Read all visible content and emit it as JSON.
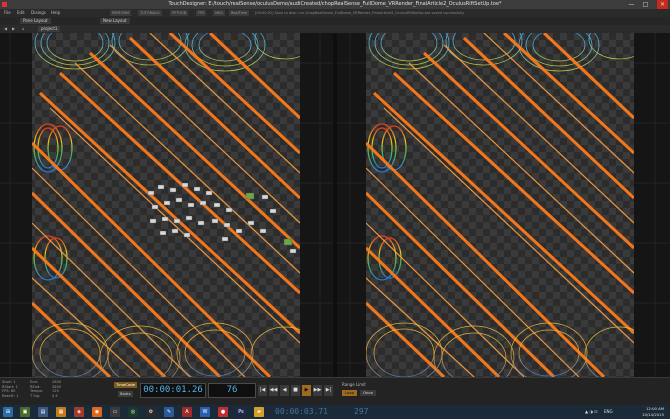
{
  "window": {
    "title": "TouchDesigner: E:/touch/realSense/oculusDemo/audiCreated/chopRealSense_FullDome_VRRender_FinalArticle2_OculusRiftSetUp.toe*",
    "controls": [
      "—",
      "□",
      "✕"
    ]
  },
  "menu": {
    "items": [
      "File",
      "Edit",
      "Dialogs",
      "Help"
    ],
    "tags": [
      "PERFORM",
      "TUTORIALS",
      "PYTHON",
      "FPS",
      "MSG",
      "RealTime"
    ],
    "path_text": "[00:00:52] Save to disk: run /chopRealSense_FullDome_VRRender_FinalArticle2_OculusRiftSetUp.toe saved successfully"
  },
  "panes": {
    "tabs": [
      "Pane Layout",
      "New Layout"
    ]
  },
  "network": {
    "crumb": "project1"
  },
  "stats": {
    "col1": [
      "Start:",
      "RStart:",
      "FPS:",
      "ResetF:"
    ],
    "col1_vals": [
      "1",
      "1",
      "60",
      "1"
    ],
    "col2": [
      "End:",
      "REnd:",
      "Tempo:",
      "T Sig:"
    ],
    "col2_vals": [
      "2800",
      "2800",
      "120",
      "4   4"
    ]
  },
  "timeline": {
    "timecode_label": "TimeCode",
    "beats_label": "Beats",
    "timecode": "00:00:01.26",
    "frame": "76",
    "transport": [
      "|◀",
      "◀◀",
      "◀",
      "■",
      "▶",
      "▶▶",
      "▶|"
    ],
    "range_label": "Range Limit",
    "range_buttons": [
      "Loop",
      "Once"
    ]
  },
  "taskbar": {
    "time_overlay": "00:00:03.71",
    "frame_overlay": "297",
    "tray_time": "12:00 AM",
    "tray_date": "10/14/2015",
    "tray_lang": "ENG"
  },
  "colors": {
    "orange": "#ff7a1a",
    "timecode_blue": "#55b2e8",
    "accent": "#9e6a1e"
  }
}
